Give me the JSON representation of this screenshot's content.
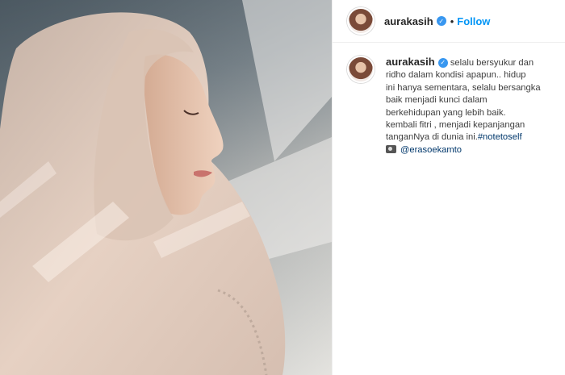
{
  "post": {
    "author": "aurakasih",
    "follow_label": "Follow",
    "separator": "•",
    "caption_lines": [
      "selalu bersyukur dan",
      "ridho dalam kondisi apapun.. hidup",
      "ini hanya sementara, selalu bersangka",
      "baik menjadi kunci dalam",
      "berkehidupan yang lebih baik.",
      "kembali fitri , menjadi kepanjangan"
    ],
    "caption_last_text": "tanganNya di dunia ini.",
    "hashtag": "#notetoself",
    "photo_credit": "@erasoekamto"
  },
  "colors": {
    "follow_blue": "#0095f6",
    "verified_blue": "#3897f0",
    "link_dark_blue": "#00376b"
  },
  "icons": {
    "verified": "verified-badge-icon",
    "camera": "camera-icon"
  }
}
